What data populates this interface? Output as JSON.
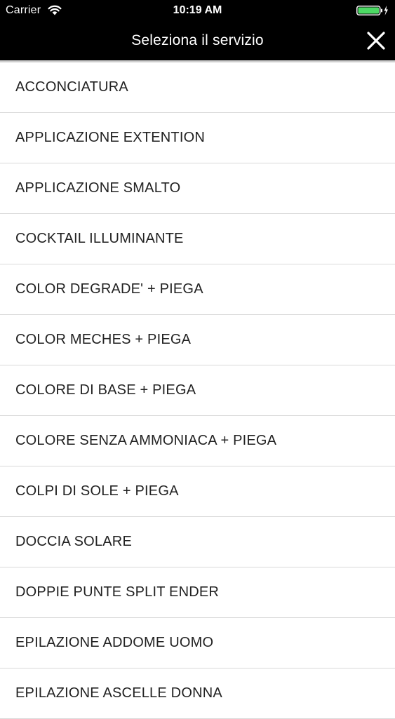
{
  "status_bar": {
    "carrier": "Carrier",
    "time": "10:19 AM",
    "wifi_icon": "wifi-icon",
    "battery_icon": "battery-icon",
    "battery_level": 1.0,
    "battery_color": "#4cd964",
    "charging_icon": "bolt-icon"
  },
  "nav": {
    "title": "Seleziona il servizio",
    "close_icon": "close-icon",
    "background": "#000000"
  },
  "services": [
    "ACCONCIATURA",
    "APPLICAZIONE EXTENTION",
    "APPLICAZIONE SMALTO",
    "COCKTAIL ILLUMINANTE",
    "COLOR DEGRADE' + PIEGA",
    "COLOR MECHES + PIEGA",
    "COLORE DI BASE + PIEGA",
    "COLORE SENZA AMMONIACA + PIEGA",
    "COLPI DI SOLE + PIEGA",
    "DOCCIA SOLARE",
    "DOPPIE PUNTE SPLIT ENDER",
    "EPILAZIONE ADDOME UOMO",
    "EPILAZIONE ASCELLE DONNA"
  ]
}
